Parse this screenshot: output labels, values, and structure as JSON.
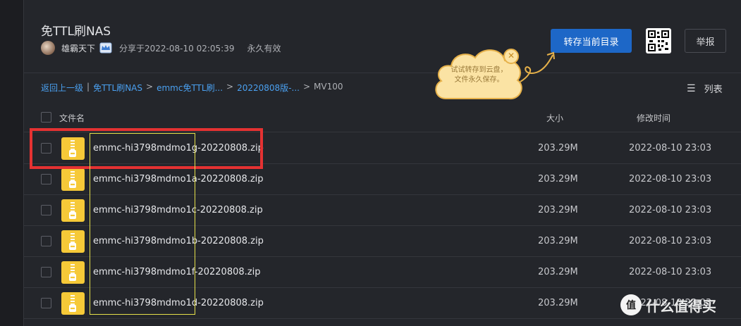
{
  "share": {
    "title": "免TTL刷NAS",
    "sharer": "雄霸天下",
    "shared_at": "分享于2022-08-10 02:05:39",
    "validity": "永久有效"
  },
  "actions": {
    "save_label": "转存当前目录",
    "report_label": "举报",
    "qr_icon": "qr-code-icon"
  },
  "tooltip": {
    "line1": "试试转存到云盘，",
    "line2": "文件永久保存。",
    "close": "✕"
  },
  "breadcrumb": {
    "back": "返回上一级",
    "divider": "|",
    "items": [
      "免TTL刷NAS",
      "emmc免TTL刷...",
      "20220808版-..."
    ],
    "current": "MV100",
    "sep": ">"
  },
  "view": {
    "label": "列表",
    "icon": "☰"
  },
  "table": {
    "col_name": "文件名",
    "col_size": "大小",
    "col_time": "修改时间",
    "rows": [
      {
        "name": "emmc-hi3798mdmo1g-20220808.zip",
        "size": "203.29M",
        "time": "2022-08-10 23:03"
      },
      {
        "name": "emmc-hi3798mdmo1a-20220808.zip",
        "size": "203.29M",
        "time": "2022-08-10 23:03"
      },
      {
        "name": "emmc-hi3798mdmo1c-20220808.zip",
        "size": "203.29M",
        "time": "2022-08-10 23:03"
      },
      {
        "name": "emmc-hi3798mdmo1b-20220808.zip",
        "size": "203.29M",
        "time": "2022-08-10 23:03"
      },
      {
        "name": "emmc-hi3798mdmo1f-20220808.zip",
        "size": "203.29M",
        "time": "2022-08-10 23:03"
      },
      {
        "name": "emmc-hi3798mdmo1d-20220808.zip",
        "size": "203.29M",
        "time": "2022-08-10 23:03"
      }
    ]
  },
  "watermark": {
    "badge": "值",
    "text": "什么值得买"
  },
  "colors": {
    "accent": "#1d67c7",
    "link": "#4aa0f0",
    "highlight_red": "#e53232",
    "highlight_yellow": "#e6e14a"
  }
}
